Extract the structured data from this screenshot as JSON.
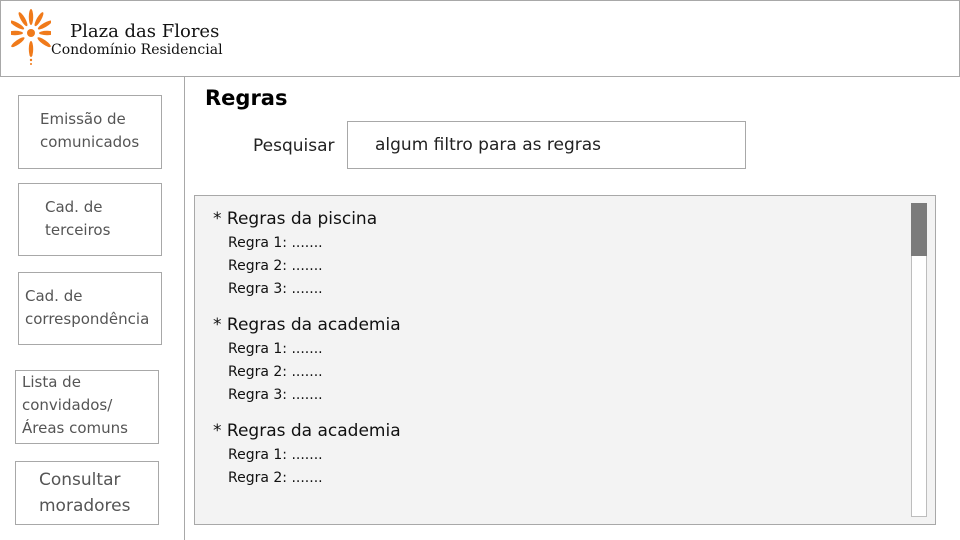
{
  "header": {
    "brand_name": "Plaza das Flores",
    "brand_subtitle": "Condomínio Residencial",
    "logo_icon": "flower-logo-icon",
    "logo_color": "#f07a1a"
  },
  "sidebar": {
    "items": [
      {
        "label": "Emissão de comunicados"
      },
      {
        "label": "Cad. de terceiros"
      },
      {
        "label": "Cad. de correspondência"
      },
      {
        "label": "Lista de convidados/ Áreas comuns"
      },
      {
        "label": "Consultar moradores"
      }
    ]
  },
  "main": {
    "title": "Regras",
    "search": {
      "label": "Pesquisar",
      "value": "algum filtro para as regras"
    },
    "rules": {
      "groups": [
        {
          "title": "* Regras da piscina",
          "items": [
            "Regra 1: .......",
            "Regra 2: .......",
            "Regra 3: ......."
          ]
        },
        {
          "title": "* Regras da academia",
          "items": [
            "Regra 1: .......",
            "Regra 2: .......",
            "Regra 3: ......."
          ]
        },
        {
          "title": "* Regras da academia",
          "items": [
            "Regra 1: .......",
            "Regra 2: ......."
          ]
        }
      ]
    }
  },
  "colors": {
    "border": "#a8a8a8",
    "panel_bg": "#f3f3f3",
    "scroll_thumb": "#7b7b7b"
  }
}
